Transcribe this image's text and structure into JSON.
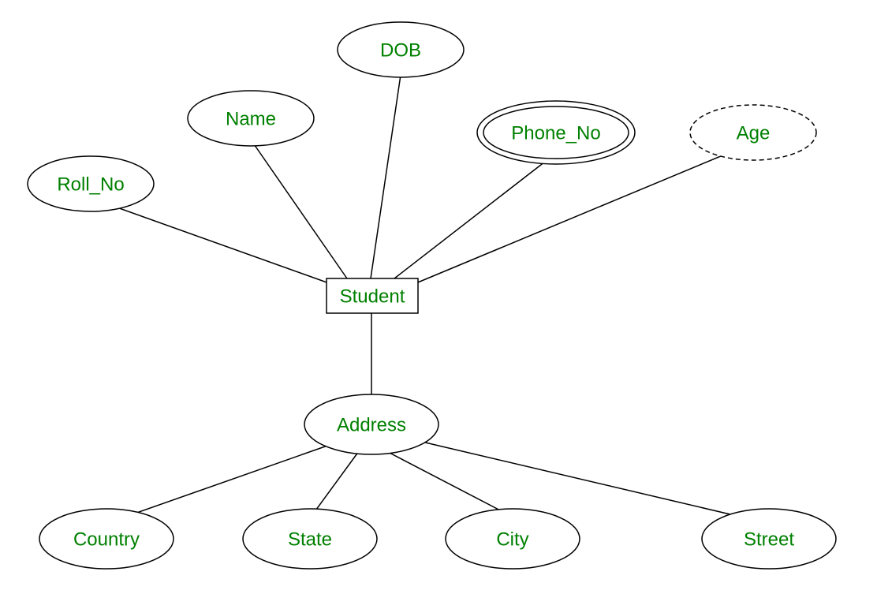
{
  "diagram": {
    "type": "er-diagram",
    "entity": {
      "label": "Student"
    },
    "attributes": {
      "roll_no": {
        "label": "Roll_No",
        "style": "simple"
      },
      "name": {
        "label": "Name",
        "style": "simple"
      },
      "dob": {
        "label": "DOB",
        "style": "simple"
      },
      "phone_no": {
        "label": "Phone_No",
        "style": "multivalued"
      },
      "age": {
        "label": "Age",
        "style": "derived"
      },
      "address": {
        "label": "Address",
        "style": "composite",
        "components": {
          "country": {
            "label": "Country"
          },
          "state": {
            "label": "State"
          },
          "city": {
            "label": "City"
          },
          "street": {
            "label": "Street"
          }
        }
      }
    }
  }
}
